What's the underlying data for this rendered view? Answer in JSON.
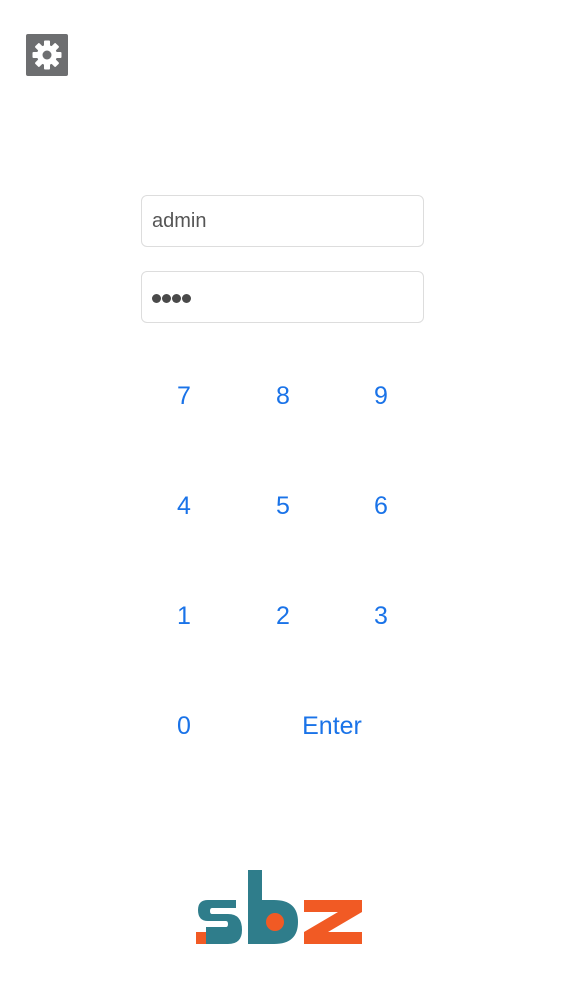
{
  "settings": {
    "icon": "gear-icon"
  },
  "login": {
    "username_value": "admin",
    "password_masked_count": 4
  },
  "keypad": {
    "keys": [
      "7",
      "8",
      "9",
      "4",
      "5",
      "6",
      "1",
      "2",
      "3",
      "0"
    ],
    "enter_label": "Enter"
  },
  "brand": {
    "logo_text": "sbz",
    "colors": {
      "teal": "#2f7d8b",
      "orange": "#f15a24",
      "key_blue": "#1a73e8",
      "gear_bg": "#6d6e70"
    }
  }
}
